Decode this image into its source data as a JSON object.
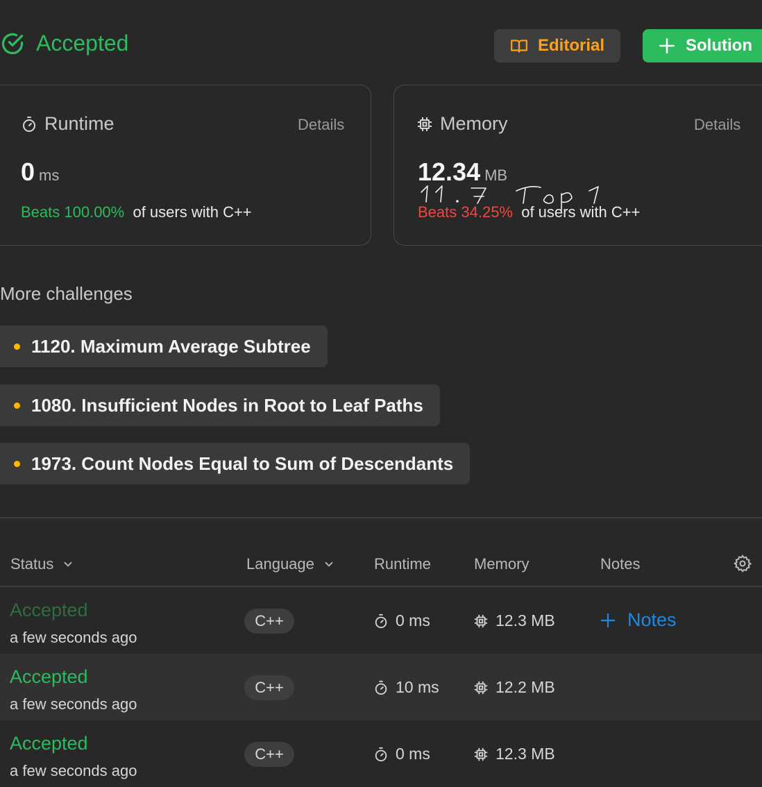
{
  "header": {
    "status": "Accepted",
    "editorial_label": "Editorial",
    "solution_label": "Solution"
  },
  "runtime_card": {
    "title": "Runtime",
    "details": "Details",
    "value": "0",
    "unit": "ms",
    "beats": "Beats 100.00%",
    "suffix": "of users with C++"
  },
  "memory_card": {
    "title": "Memory",
    "details": "Details",
    "value": "12.34",
    "unit": "MB",
    "beats": "Beats 34.25%",
    "suffix": "of users with C++",
    "handwritten_note": "11.7 Top 1"
  },
  "more_challenges": {
    "title": "More challenges",
    "items": [
      {
        "label": "1120. Maximum Average Subtree"
      },
      {
        "label": "1080. Insufficient Nodes in Root to Leaf Paths"
      },
      {
        "label": "1973. Count Nodes Equal to Sum of Descendants"
      }
    ]
  },
  "table": {
    "columns": {
      "status": "Status",
      "language": "Language",
      "runtime": "Runtime",
      "memory": "Memory",
      "notes": "Notes"
    },
    "rows": [
      {
        "status": "Accepted",
        "time": "a few seconds ago",
        "language": "C++",
        "runtime": "0 ms",
        "memory": "12.3 MB",
        "notes": "Notes"
      },
      {
        "status": "Accepted",
        "time": "a few seconds ago",
        "language": "C++",
        "runtime": "10 ms",
        "memory": "12.2 MB"
      },
      {
        "status": "Accepted",
        "time": "a few seconds ago",
        "language": "C++",
        "runtime": "0 ms",
        "memory": "12.3 MB"
      }
    ]
  },
  "colors": {
    "accepted": "#2cbb5d",
    "accepted_dim": "#2f6b43",
    "editorial": "#ffa116",
    "notes_link": "#1e88e5",
    "beats_bad": "#ef4743"
  }
}
